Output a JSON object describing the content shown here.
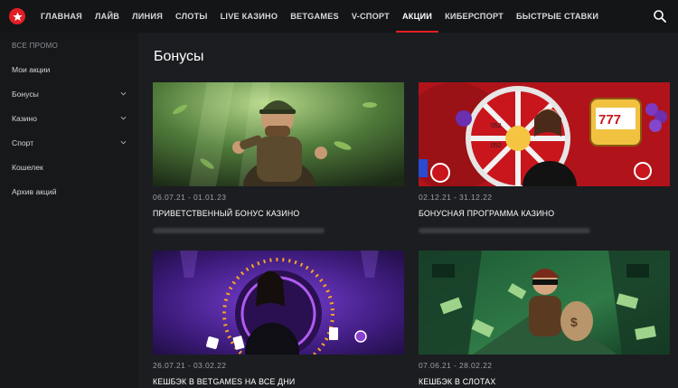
{
  "nav": {
    "items": [
      {
        "label": "ГЛАВНАЯ",
        "active": false
      },
      {
        "label": "ЛАЙВ",
        "active": false
      },
      {
        "label": "ЛИНИЯ",
        "active": false
      },
      {
        "label": "СЛОТЫ",
        "active": false
      },
      {
        "label": "LIVE КАЗИНО",
        "active": false
      },
      {
        "label": "BETGAMES",
        "active": false
      },
      {
        "label": "V-СПОРТ",
        "active": false
      },
      {
        "label": "АКЦИИ",
        "active": true
      },
      {
        "label": "КИБЕРСПОРТ",
        "active": false
      },
      {
        "label": "БЫСТРЫЕ СТАВКИ",
        "active": false
      }
    ],
    "search_icon": "search-icon",
    "accent": "#e31e24"
  },
  "sidebar": {
    "header": "ВСЕ ПРОМО",
    "items": [
      {
        "label": "Мои акции",
        "expandable": false
      },
      {
        "label": "Бонусы",
        "expandable": true
      },
      {
        "label": "Казино",
        "expandable": true
      },
      {
        "label": "Спорт",
        "expandable": true
      },
      {
        "label": "Кошелек",
        "expandable": false
      },
      {
        "label": "Архив акций",
        "expandable": false
      }
    ]
  },
  "main": {
    "title": "Бонусы",
    "cards": [
      {
        "dates": "06.07.21 - 01.01.23",
        "title": "ПРИВЕТСТВЕННЫЙ БОНУС КАЗИНО"
      },
      {
        "dates": "02.12.21 - 31.12.22",
        "title": "БОНУСНАЯ ПРОГРАММА КАЗИНО"
      },
      {
        "dates": "26.07.21 - 03.02.22",
        "title": "КЕШБЭК В BETGAMES НА ВСЕ ДНИ"
      },
      {
        "dates": "07.06.21 - 28.02.22",
        "title": "КЕШБЭК В СЛОТАХ"
      }
    ]
  }
}
